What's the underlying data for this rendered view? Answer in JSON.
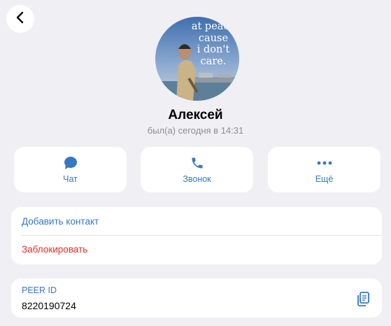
{
  "header": {
    "back_icon": "chevron-left-icon"
  },
  "profile": {
    "avatar_caption": "at peace\ncause\ni don't\ncare.",
    "name": "Алексей",
    "status": "был(а) сегодня в 14:31"
  },
  "actions": [
    {
      "icon": "chat-bubble-icon",
      "label": "Чат"
    },
    {
      "icon": "phone-icon",
      "label": "Звонок"
    },
    {
      "icon": "more-icon",
      "label": "Ещё"
    }
  ],
  "contact_actions": {
    "add_contact": "Добавить контакт",
    "block": "Заблокировать"
  },
  "peer": {
    "label": "PEER ID",
    "value": "8220190724",
    "copy_icon": "copy-icon"
  },
  "colors": {
    "background": "#efeff4",
    "card": "#ffffff",
    "accent": "#3478c6",
    "danger": "#e0302a",
    "secondary_text": "#8e8e93"
  }
}
